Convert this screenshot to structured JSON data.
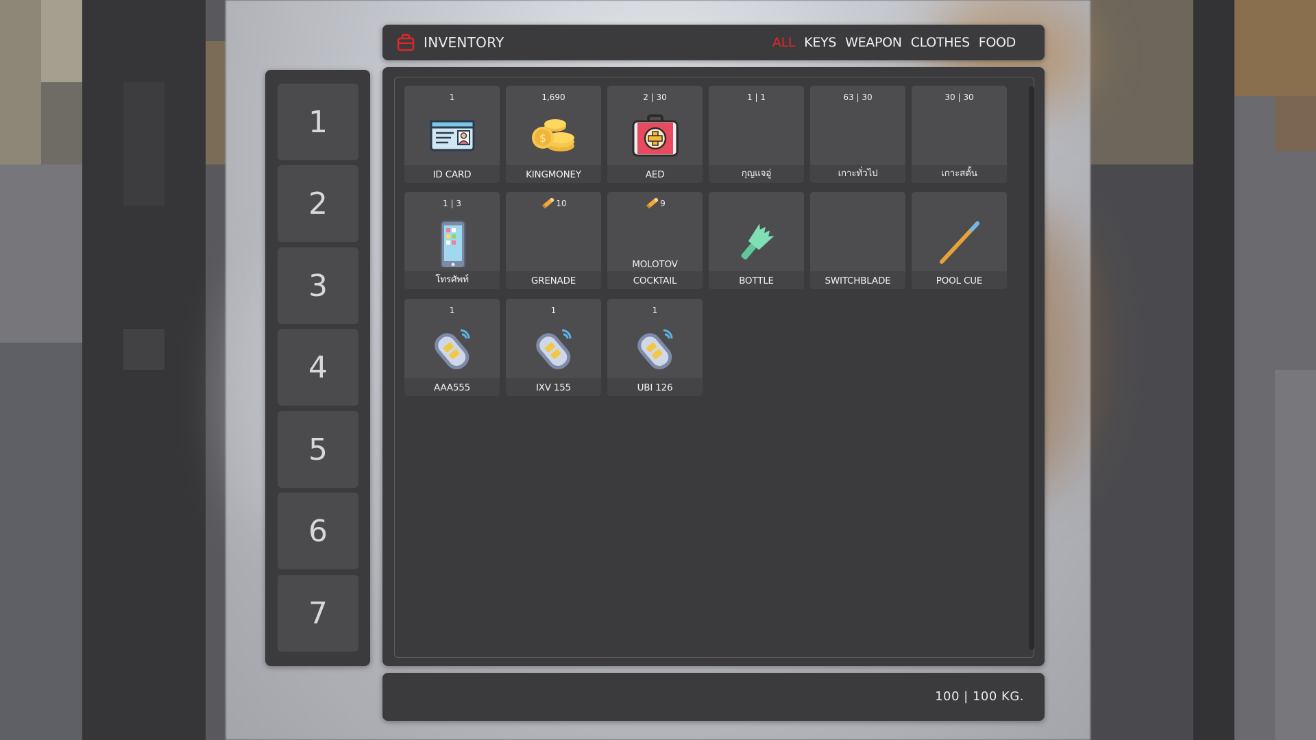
{
  "header": {
    "title": "INVENTORY",
    "tabs": [
      "ALL",
      "KEYS",
      "WEAPON",
      "CLOTHES",
      "FOOD"
    ]
  },
  "hotbar": [
    "1",
    "2",
    "3",
    "4",
    "5",
    "6",
    "7"
  ],
  "items": [
    {
      "count": "1",
      "label": "ID CARD",
      "icon": "id-card-icon"
    },
    {
      "count": "1,690",
      "label": "KINGMONEY",
      "icon": "coins-icon"
    },
    {
      "count": "2 | 30",
      "label": "AED",
      "icon": "first-aid-kit-icon"
    },
    {
      "count": "1 | 1",
      "label": "กุญแจอู่",
      "icon": ""
    },
    {
      "count": "63 | 30",
      "label": "เกาะทั่วไป",
      "icon": ""
    },
    {
      "count": "30 | 30",
      "label": "เกาะสตั้น",
      "icon": ""
    },
    {
      "count": "1 | 3",
      "label": "โทรศัพท์",
      "icon": "phone-icon"
    },
    {
      "count": "10",
      "label": "GRENADE",
      "icon": "ammo-icon"
    },
    {
      "count": "9",
      "label": "COCKTAIL",
      "label_top": "MOLOTOV",
      "icon": "ammo-icon"
    },
    {
      "count": "",
      "label": "BOTTLE",
      "icon": "broken-bottle-icon"
    },
    {
      "count": "",
      "label": "SWITCHBLADE",
      "icon": ""
    },
    {
      "count": "",
      "label": "POOL CUE",
      "icon": "pool-cue-icon"
    },
    {
      "count": "1",
      "label": "AAA555",
      "icon": "car-key-icon"
    },
    {
      "count": "1",
      "label": "IXV 155",
      "icon": "car-key-icon"
    },
    {
      "count": "1",
      "label": "UBI 126",
      "icon": "car-key-icon"
    }
  ],
  "footer": {
    "weight": "100 | 100 KG."
  },
  "colors": {
    "accent": "#e0262a",
    "panel": "#3b3b3d",
    "slot": "#4d4d4f"
  }
}
